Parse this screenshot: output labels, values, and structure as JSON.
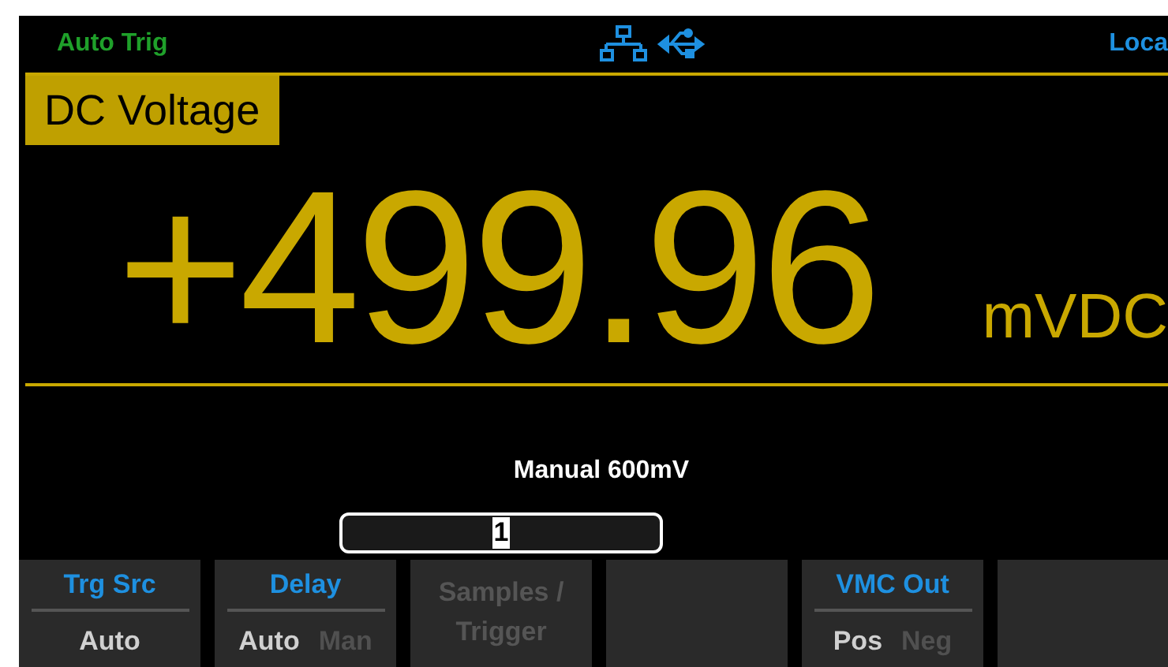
{
  "status_bar": {
    "trigger": "Auto Trig",
    "remote": "Loca"
  },
  "function": "DC Voltage",
  "reading": {
    "value": "+499.96",
    "unit": "mVDC"
  },
  "range": "Manual 600mV",
  "input": {
    "value": "1"
  },
  "softkeys": [
    {
      "kind": "menu",
      "label": "Trg Src",
      "disabled": false,
      "options": [
        {
          "text": "Auto",
          "selected": true
        }
      ]
    },
    {
      "kind": "menu",
      "label": "Delay",
      "disabled": false,
      "options": [
        {
          "text": "Auto",
          "selected": true
        },
        {
          "text": "Man",
          "selected": false
        }
      ]
    },
    {
      "kind": "menu",
      "label": "Samples / Trigger",
      "disabled": true
    },
    {
      "kind": "blank"
    },
    {
      "kind": "menu",
      "label": "VMC Out",
      "disabled": false,
      "options": [
        {
          "text": "Pos",
          "selected": true
        },
        {
          "text": "Neg",
          "selected": false
        }
      ]
    },
    {
      "kind": "blank"
    }
  ]
}
